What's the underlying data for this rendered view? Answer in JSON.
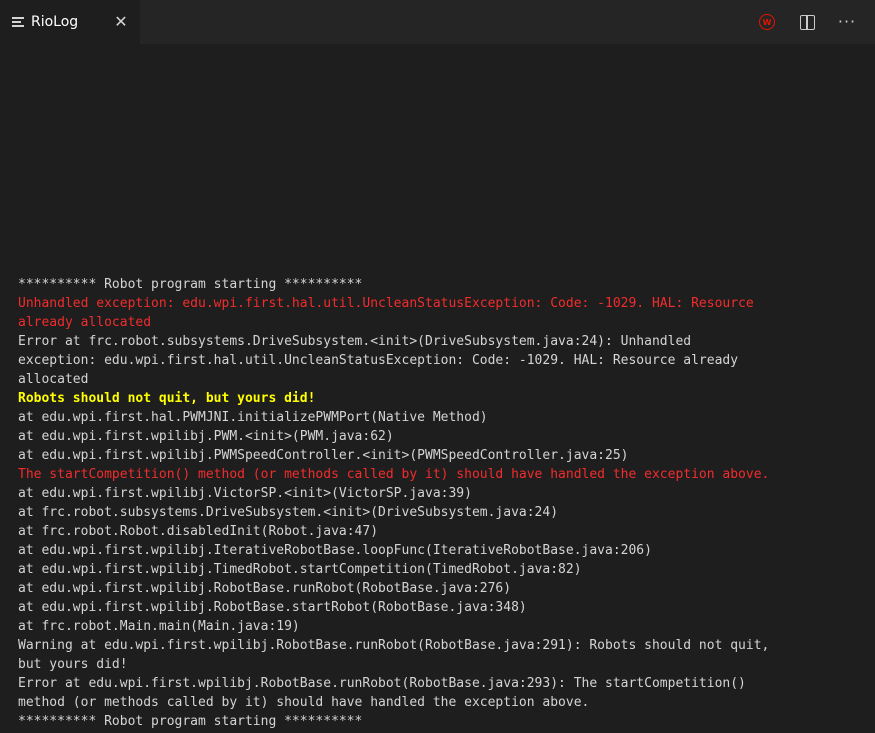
{
  "tab": {
    "title": "RioLog",
    "close_glyph": "✕",
    "icon": "list-lines-icon"
  },
  "actions": {
    "wpilib_badge": "W",
    "wpilib_icon": "wpilib-logo-icon",
    "split_icon": "split-editor-icon",
    "more_glyph": "···",
    "more_icon": "more-actions-icon"
  },
  "colors": {
    "background": "#1e1e1e",
    "tabbar": "#252526",
    "normal_text": "#d4d4d4",
    "error_text": "#f22c2c",
    "warning_text": "#ffff00",
    "wpilib_red": "#e51400"
  },
  "log": {
    "lines": [
      {
        "text": "********** Robot program starting **********",
        "kind": "normal"
      },
      {
        "text": "Unhandled exception: edu.wpi.first.hal.util.UncleanStatusException: Code: -1029. HAL: Resource",
        "kind": "error"
      },
      {
        "text": "already allocated",
        "kind": "error"
      },
      {
        "text": "Error at frc.robot.subsystems.DriveSubsystem.<init>(DriveSubsystem.java:24): Unhandled",
        "kind": "normal"
      },
      {
        "text": "exception: edu.wpi.first.hal.util.UncleanStatusException: Code: -1029. HAL: Resource already",
        "kind": "normal"
      },
      {
        "text": "allocated",
        "kind": "normal"
      },
      {
        "text": "Robots should not quit, but yours did!",
        "kind": "warning"
      },
      {
        "text": "at edu.wpi.first.hal.PWMJNI.initializePWMPort(Native Method)",
        "kind": "normal"
      },
      {
        "text": "at edu.wpi.first.wpilibj.PWM.<init>(PWM.java:62)",
        "kind": "normal"
      },
      {
        "text": "at edu.wpi.first.wpilibj.PWMSpeedController.<init>(PWMSpeedController.java:25)",
        "kind": "normal"
      },
      {
        "text": "The startCompetition() method (or methods called by it) should have handled the exception above.",
        "kind": "error"
      },
      {
        "text": "at edu.wpi.first.wpilibj.VictorSP.<init>(VictorSP.java:39)",
        "kind": "normal"
      },
      {
        "text": "at frc.robot.subsystems.DriveSubsystem.<init>(DriveSubsystem.java:24)",
        "kind": "normal"
      },
      {
        "text": "at frc.robot.Robot.disabledInit(Robot.java:47)",
        "kind": "normal"
      },
      {
        "text": "at edu.wpi.first.wpilibj.IterativeRobotBase.loopFunc(IterativeRobotBase.java:206)",
        "kind": "normal"
      },
      {
        "text": "at edu.wpi.first.wpilibj.TimedRobot.startCompetition(TimedRobot.java:82)",
        "kind": "normal"
      },
      {
        "text": "at edu.wpi.first.wpilibj.RobotBase.runRobot(RobotBase.java:276)",
        "kind": "normal"
      },
      {
        "text": "at edu.wpi.first.wpilibj.RobotBase.startRobot(RobotBase.java:348)",
        "kind": "normal"
      },
      {
        "text": "at frc.robot.Main.main(Main.java:19)",
        "kind": "normal"
      },
      {
        "text": "Warning at edu.wpi.first.wpilibj.RobotBase.runRobot(RobotBase.java:291): Robots should not quit,",
        "kind": "normal"
      },
      {
        "text": "but yours did!",
        "kind": "normal"
      },
      {
        "text": "Error at edu.wpi.first.wpilibj.RobotBase.runRobot(RobotBase.java:293): The startCompetition()",
        "kind": "normal"
      },
      {
        "text": "method (or methods called by it) should have handled the exception above.",
        "kind": "normal"
      },
      {
        "text": "********** Robot program starting **********",
        "kind": "normal"
      }
    ]
  }
}
